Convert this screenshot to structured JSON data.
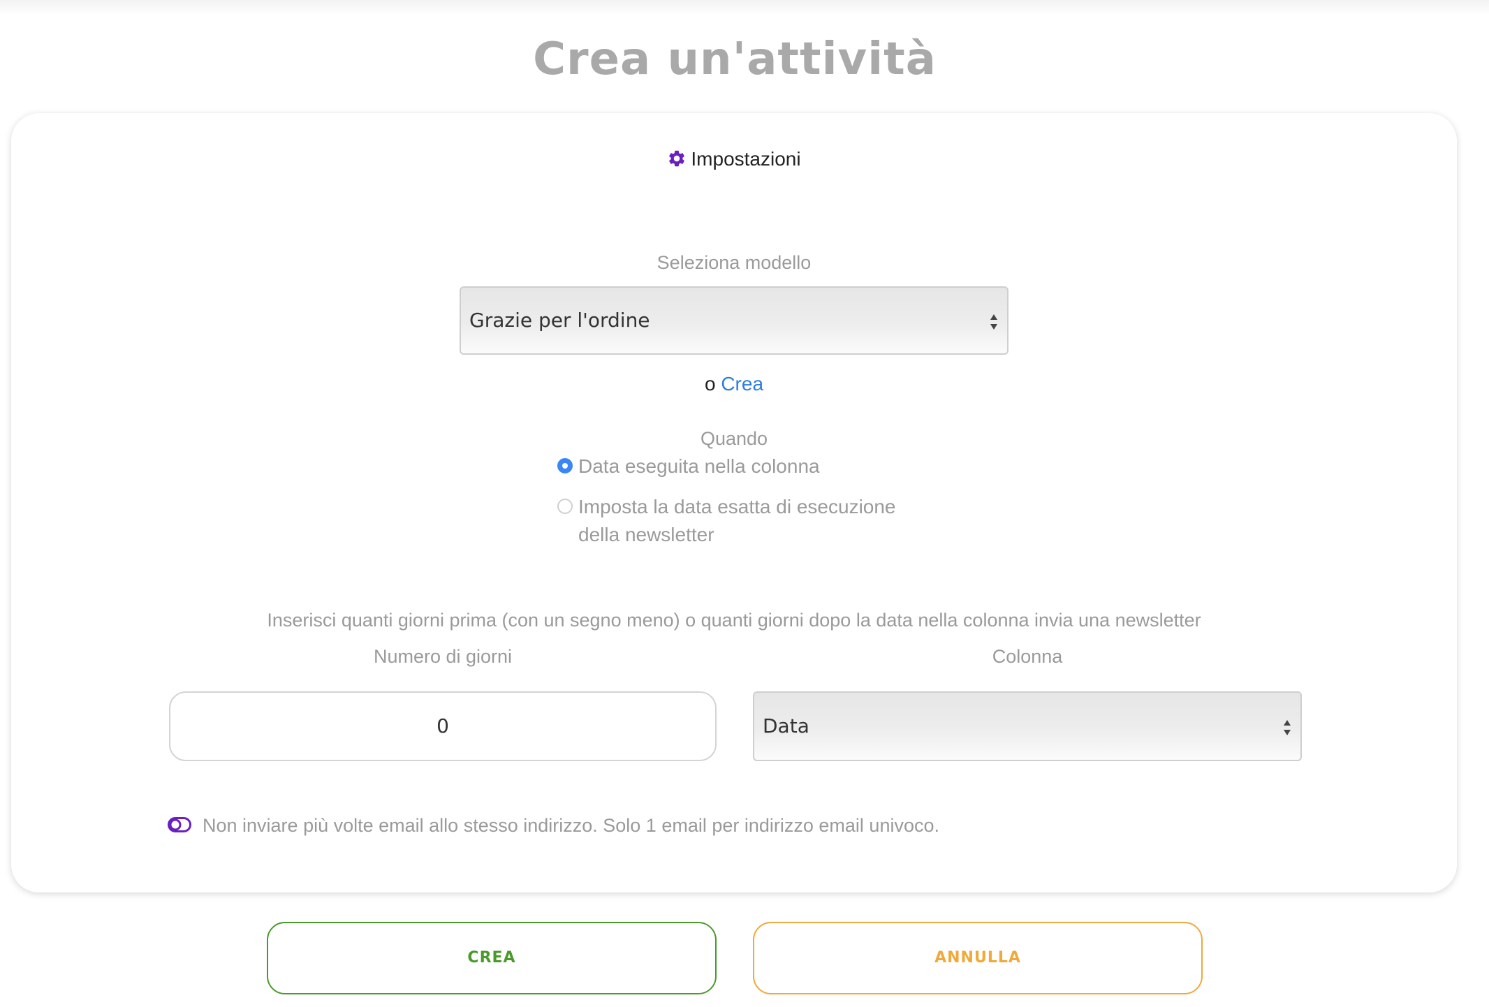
{
  "page": {
    "title": "Crea un'attività"
  },
  "settings": {
    "label": "Impostazioni",
    "icon": "gear-icon",
    "icon_color": "#6a1fc0"
  },
  "template": {
    "label": "Seleziona modello",
    "selected": "Grazie per l'ordine",
    "or_text": "o",
    "create_link": "Crea"
  },
  "when": {
    "label": "Quando",
    "options": [
      {
        "label": "Data eseguita nella colonna",
        "checked": true
      },
      {
        "label": "Imposta la data esatta di esecuzione della newsletter",
        "checked": false
      }
    ]
  },
  "days": {
    "instructions": "Inserisci quanti giorni prima (con un segno meno) o quanti giorni dopo la data nella colonna invia una newsletter",
    "number_label": "Numero di giorni",
    "number_value": "0",
    "column_label": "Colonna",
    "column_selected": "Data"
  },
  "unique": {
    "label": "Non inviare più volte email allo stesso indirizzo. Solo 1 email per indirizzo email univoco.",
    "icon": "toggle-icon",
    "icon_color": "#6a1fc0"
  },
  "actions": {
    "create_label": "CREA",
    "cancel_label": "ANNULLA",
    "create_color": "#4a9a2a",
    "cancel_color": "#f0a93a"
  },
  "colors": {
    "accent": "#3a86f5",
    "link": "#2b7de0"
  }
}
